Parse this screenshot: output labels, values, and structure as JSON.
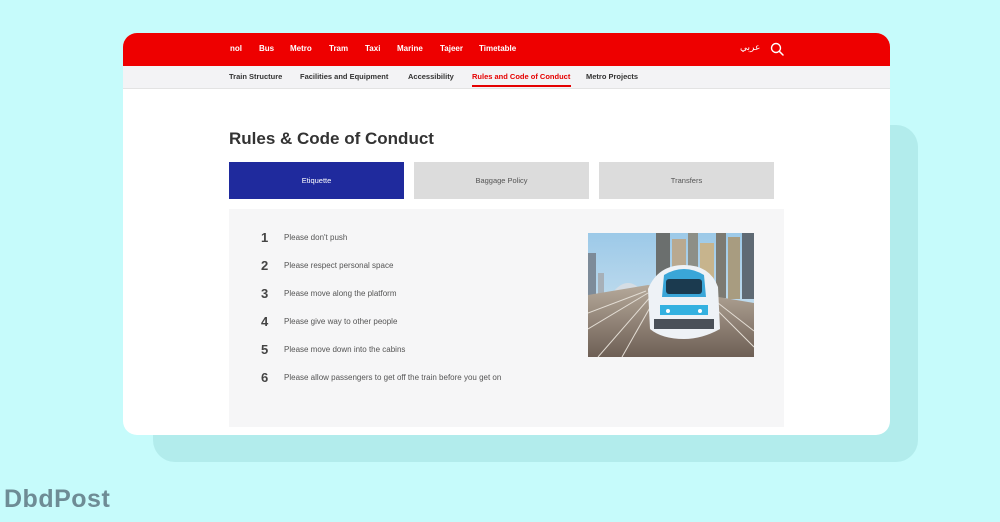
{
  "topnav": {
    "items": [
      "nol",
      "Bus",
      "Metro",
      "Tram",
      "Taxi",
      "Marine",
      "Tajeer",
      "Timetable"
    ],
    "language": "عربي",
    "search_icon": "search-icon"
  },
  "subnav": {
    "items": [
      "Train Structure",
      "Facilities and Equipment",
      "Accessibility",
      "Rules and Code of Conduct",
      "Metro Projects"
    ],
    "active": "Rules and Code of Conduct"
  },
  "page": {
    "title": "Rules & Code of Conduct"
  },
  "tabs": [
    {
      "label": "Etiquette",
      "active": true
    },
    {
      "label": "Baggage Policy",
      "active": false
    },
    {
      "label": "Transfers",
      "active": false
    }
  ],
  "rules": [
    {
      "num": "1",
      "text": "Please don't push"
    },
    {
      "num": "2",
      "text": "Please respect personal space"
    },
    {
      "num": "3",
      "text": "Please move along the platform"
    },
    {
      "num": "4",
      "text": "Please give way to other people"
    },
    {
      "num": "5",
      "text": "Please move down into the cabins"
    },
    {
      "num": "6",
      "text": "Please allow passengers to get off the train before you get on"
    }
  ],
  "branding": {
    "logo_text": "DbdPost"
  },
  "colors": {
    "brand_red": "#ee0000",
    "active_tab": "#1f2a9d",
    "background": "#c6fbfb"
  }
}
